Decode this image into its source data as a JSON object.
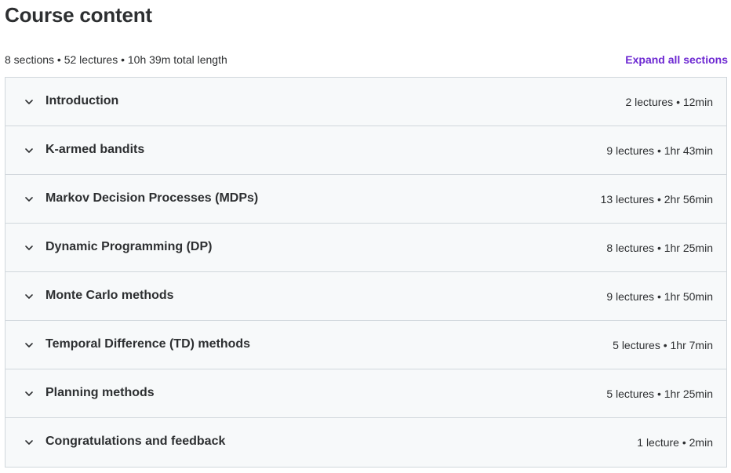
{
  "header": {
    "title": "Course content"
  },
  "summary": {
    "text": "8 sections • 52 lectures • 10h 39m total length",
    "expand_label": "Expand all sections"
  },
  "colors": {
    "accent": "#6d28d2",
    "text": "#2d2f31",
    "row_background": "#f7f9fa",
    "border": "#d1d7dc"
  },
  "sections": [
    {
      "title": "Introduction",
      "meta": "2 lectures • 12min",
      "icon": "chevron-down-icon"
    },
    {
      "title": "K-armed bandits",
      "meta": "9 lectures • 1hr 43min",
      "icon": "chevron-down-icon"
    },
    {
      "title": "Markov Decision Processes (MDPs)",
      "meta": "13 lectures • 2hr 56min",
      "icon": "chevron-down-icon"
    },
    {
      "title": "Dynamic Programming (DP)",
      "meta": "8 lectures • 1hr 25min",
      "icon": "chevron-down-icon"
    },
    {
      "title": "Monte Carlo methods",
      "meta": "9 lectures • 1hr 50min",
      "icon": "chevron-down-icon"
    },
    {
      "title": "Temporal Difference (TD) methods",
      "meta": "5 lectures • 1hr 7min",
      "icon": "chevron-down-icon"
    },
    {
      "title": "Planning methods",
      "meta": "5 lectures • 1hr 25min",
      "icon": "chevron-down-icon"
    },
    {
      "title": "Congratulations and feedback",
      "meta": "1 lecture • 2min",
      "icon": "chevron-down-icon"
    }
  ]
}
